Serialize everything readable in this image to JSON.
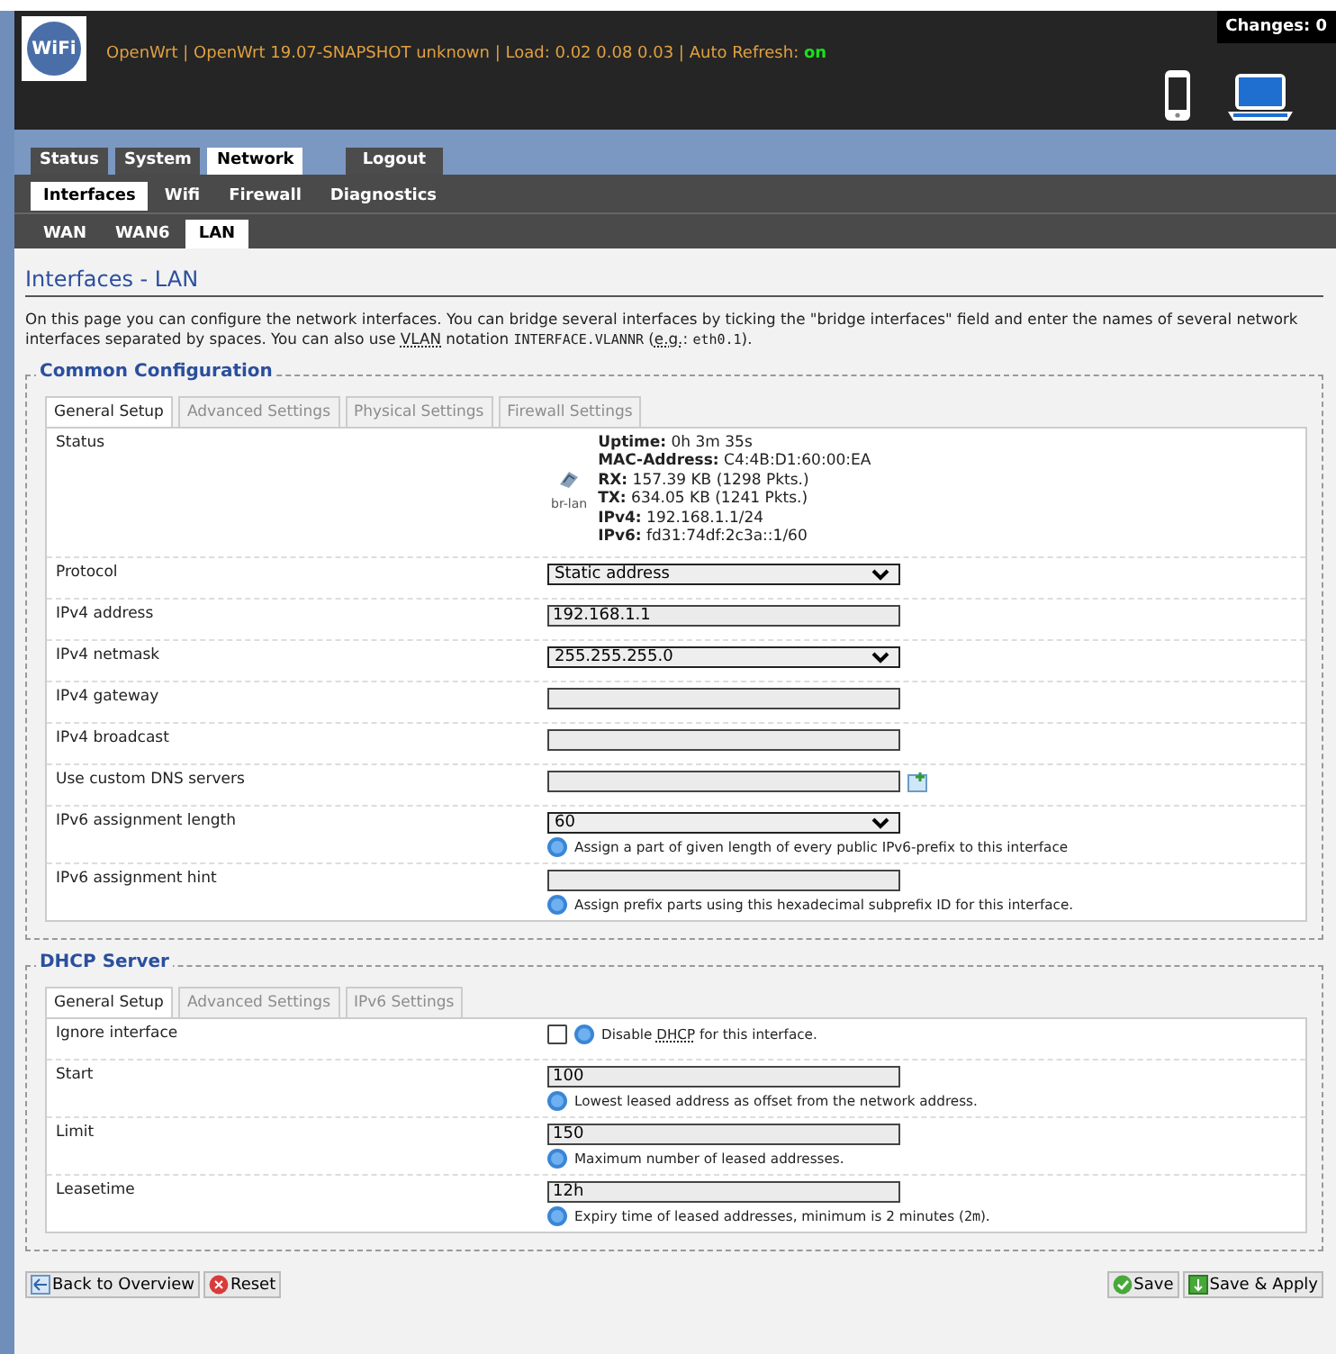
{
  "header": {
    "logo": "WiFi",
    "info": "OpenWrt | OpenWrt 19.07-SNAPSHOT unknown | Load: 0.02 0.08 0.03 | Auto Refresh: ",
    "auto_refresh": "on",
    "changes": "Changes: 0"
  },
  "menu": [
    {
      "label": "Status",
      "selected": false,
      "kind": "tab"
    },
    {
      "label": "System",
      "selected": false,
      "kind": "tab"
    },
    {
      "label": "Network",
      "selected": true,
      "kind": "tab"
    },
    {
      "label": "Logout",
      "selected": false,
      "kind": "logout"
    }
  ],
  "submenu": [
    {
      "label": "Interfaces",
      "selected": true
    },
    {
      "label": "Wifi",
      "selected": false
    },
    {
      "label": "Firewall",
      "selected": false
    },
    {
      "label": "Diagnostics",
      "selected": false
    }
  ],
  "subsubmenu": [
    {
      "label": "WAN",
      "selected": false
    },
    {
      "label": "WAN6",
      "selected": false
    },
    {
      "label": "LAN",
      "selected": true
    }
  ],
  "page": {
    "title": "Interfaces - LAN",
    "description": [
      {
        "kind": "text",
        "text": "On this page you can configure the network interfaces. You can bridge several interfaces by ticking the \"bridge interfaces\" field and enter the names of several network interfaces separated by spaces. You can also use "
      },
      {
        "kind": "abbr",
        "text": "VLAN"
      },
      {
        "kind": "text",
        "text": " notation "
      },
      {
        "kind": "code",
        "text": "INTERFACE.VLANNR"
      },
      {
        "kind": "text",
        "text": " ("
      },
      {
        "kind": "abbr",
        "text": "e.g."
      },
      {
        "kind": "text",
        "text": ": "
      },
      {
        "kind": "code",
        "text": "eth0.1"
      },
      {
        "kind": "text",
        "text": ")."
      }
    ]
  },
  "sections": [
    {
      "title": "Common Configuration",
      "tabs": [
        {
          "label": "General Setup",
          "selected": true
        },
        {
          "label": "Advanced Settings",
          "selected": false
        },
        {
          "label": "Physical Settings",
          "selected": false
        },
        {
          "label": "Firewall Settings",
          "selected": false
        }
      ],
      "rows": [
        {
          "kind": "status",
          "label": "Status",
          "device": "br-lan",
          "lines": [
            {
              "key": "Uptime:",
              "value": "0h 3m 35s"
            },
            {
              "key": "MAC-Address:",
              "value": "C4:4B:D1:60:00:EA"
            },
            {
              "key": "RX:",
              "value": "157.39 KB (1298 Pkts.)"
            },
            {
              "key": "TX:",
              "value": "634.05 KB (1241 Pkts.)"
            },
            {
              "key": "IPv4:",
              "value": "192.168.1.1/24"
            },
            {
              "key": "IPv6:",
              "value": "fd31:74df:2c3a::1/60"
            }
          ]
        },
        {
          "kind": "select",
          "label": "Protocol",
          "value": "Static address"
        },
        {
          "kind": "input",
          "label": "IPv4 address",
          "value": "192.168.1.1"
        },
        {
          "kind": "select",
          "label": "IPv4 netmask",
          "value": "255.255.255.0"
        },
        {
          "kind": "input",
          "label": "IPv4 gateway"
        },
        {
          "kind": "input",
          "label": "IPv4 broadcast"
        },
        {
          "kind": "dynlist",
          "label": "Use custom DNS servers"
        },
        {
          "kind": "select",
          "label": "IPv6 assignment length",
          "value": "60",
          "hint": [
            {
              "kind": "text",
              "text": "Assign a part of given length of every public IPv6-prefix to this interface"
            }
          ]
        },
        {
          "kind": "input",
          "label": "IPv6 assignment hint",
          "hint": [
            {
              "kind": "text",
              "text": "Assign prefix parts using this hexadecimal subprefix ID for this interface."
            }
          ]
        }
      ]
    },
    {
      "title": "DHCP Server",
      "tabs": [
        {
          "label": "General Setup",
          "selected": true
        },
        {
          "label": "Advanced Settings",
          "selected": false
        },
        {
          "label": "IPv6 Settings",
          "selected": false
        }
      ],
      "rows": [
        {
          "kind": "checkbox",
          "label": "Ignore interface",
          "checked": false,
          "hint": [
            {
              "kind": "text",
              "text": "Disable "
            },
            {
              "kind": "abbr",
              "text": "DHCP"
            },
            {
              "kind": "text",
              "text": " for this interface."
            }
          ]
        },
        {
          "kind": "input",
          "label": "Start",
          "value": "100",
          "hint": [
            {
              "kind": "text",
              "text": "Lowest leased address as offset from the network address."
            }
          ]
        },
        {
          "kind": "input",
          "label": "Limit",
          "value": "150",
          "hint": [
            {
              "kind": "text",
              "text": "Maximum number of leased addresses."
            }
          ]
        },
        {
          "kind": "input",
          "label": "Leasetime",
          "value": "12h",
          "hint": [
            {
              "kind": "text",
              "text": "Expiry time of leased addresses, minimum is 2 minutes ("
            },
            {
              "kind": "code",
              "text": "2m"
            },
            {
              "kind": "text",
              "text": ")."
            }
          ]
        }
      ]
    }
  ],
  "footer": {
    "left": [
      {
        "label": "Back to Overview",
        "kind": "back"
      },
      {
        "label": "Reset",
        "kind": "reset"
      }
    ],
    "right": [
      {
        "label": "Save",
        "kind": "save"
      },
      {
        "label": "Save & Apply",
        "kind": "apply"
      }
    ]
  }
}
